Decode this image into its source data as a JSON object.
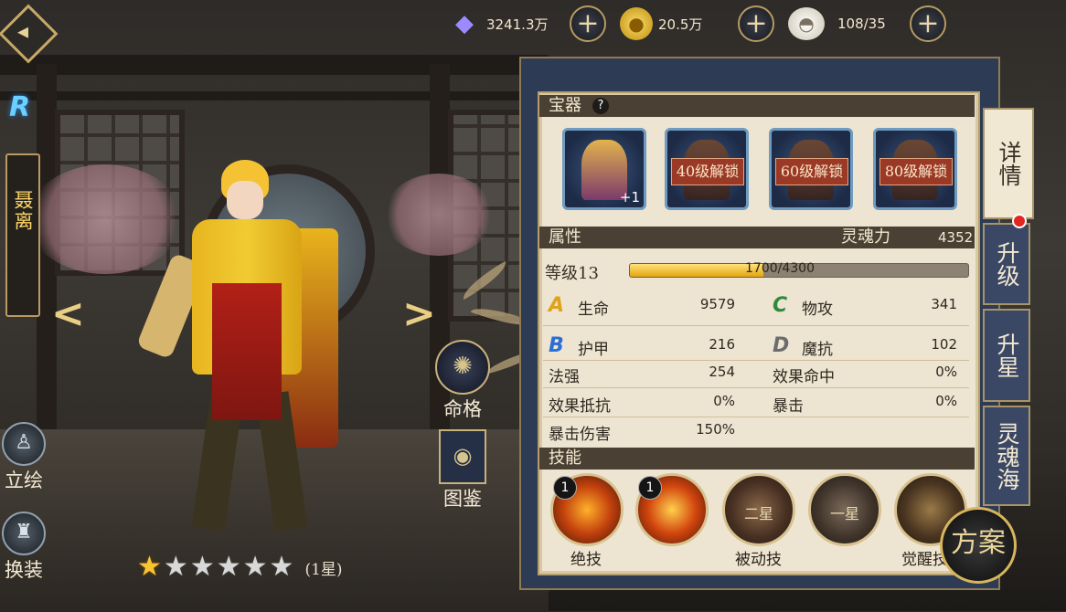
{
  "currencies": [
    {
      "icon": "crystal-icon",
      "value": "3241.3万",
      "color": "#8a7cff"
    },
    {
      "icon": "gold-coin-icon",
      "value": "20.5万",
      "color": "#e8b923"
    },
    {
      "icon": "bun-stamina-icon",
      "value": "108/35",
      "color": "#f1efe6"
    }
  ],
  "plus_symbol": "+",
  "left": {
    "rank": "R",
    "name": "聂离",
    "buttons": [
      {
        "label": "立绘",
        "icon": "portrait-icon"
      },
      {
        "label": "换装",
        "icon": "outfit-icon"
      }
    ],
    "prev": "<",
    "next": ">"
  },
  "stars": {
    "filled": 1,
    "total": 6,
    "text": "(1星)"
  },
  "mid_buttons": [
    {
      "label": "命格",
      "icon": "fate-icon"
    },
    {
      "label": "图鉴",
      "icon": "codex-icon"
    }
  ],
  "treasure": {
    "title": "宝器",
    "help": "?",
    "slots": [
      {
        "lock_text": "",
        "extra": "+1"
      },
      {
        "lock_text": "40级解锁"
      },
      {
        "lock_text": "60级解锁"
      },
      {
        "lock_text": "80级解锁"
      }
    ]
  },
  "attributes_header": {
    "title": "属性",
    "soul_label": "灵魂力",
    "soul_value": "4352"
  },
  "level": {
    "label": "等级13",
    "current": 1700,
    "max": 4300,
    "text": "1700/4300"
  },
  "attrs": {
    "hp": {
      "letter": "A",
      "name": "生命",
      "value": "9579",
      "color": "#e0a11b"
    },
    "atk": {
      "letter": "C",
      "name": "物攻",
      "value": "341",
      "color": "#2f8a3a"
    },
    "armor": {
      "letter": "B",
      "name": "护甲",
      "value": "216",
      "color": "#2a6fd6"
    },
    "mres": {
      "letter": "D",
      "name": "魔抗",
      "value": "102",
      "color": "#6c6c6c"
    },
    "spell": {
      "name": "法强",
      "value": "254"
    },
    "hit": {
      "name": "效果命中",
      "value": "0%"
    },
    "resist": {
      "name": "效果抵抗",
      "value": "0%"
    },
    "crit": {
      "name": "暴击",
      "value": "0%"
    },
    "critdmg": {
      "name": "暴击伤害",
      "value": "150%"
    }
  },
  "skills": {
    "title": "技能",
    "items": [
      {
        "badge": "1",
        "inner": "",
        "icon": "ultimate-skill-icon"
      },
      {
        "badge": "1",
        "inner": "",
        "icon": "ultimate-skill-2-icon"
      },
      {
        "badge": "",
        "inner": "二星",
        "icon": "passive-skill-icon"
      },
      {
        "badge": "",
        "inner": "一星",
        "icon": "passive-skill-2-icon"
      },
      {
        "badge": "",
        "inner": "",
        "icon": "awaken-skill-icon"
      }
    ],
    "captions": [
      "绝技",
      "被动技",
      "觉醒技"
    ]
  },
  "tabs": [
    "详情",
    "升级",
    "升星",
    "灵魂海"
  ],
  "plan_button": "方案"
}
